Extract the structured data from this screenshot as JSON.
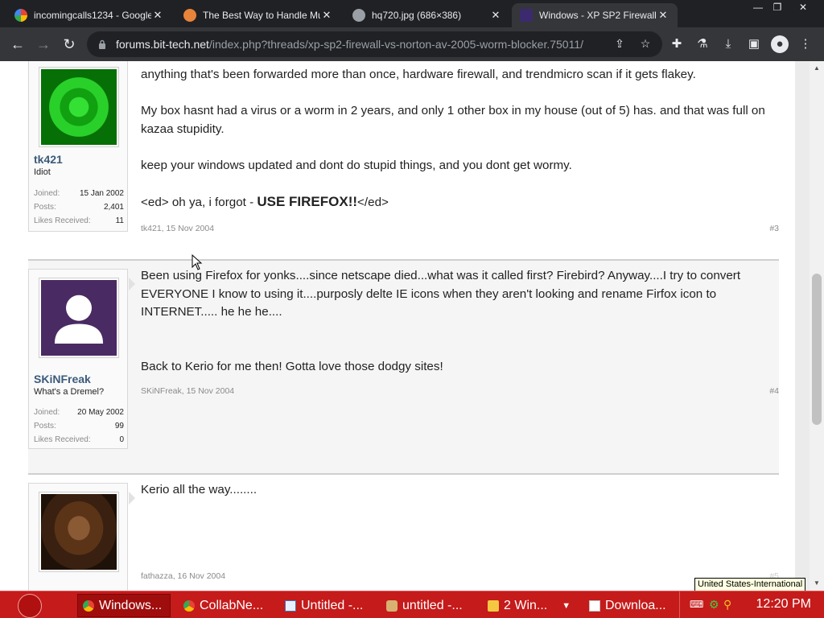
{
  "browser": {
    "tabs": [
      {
        "title": "incomingcalls1234 - Google S",
        "icon": "google-icon",
        "active": false
      },
      {
        "title": "The Best Way to Handle Mul",
        "icon": "site-icon",
        "active": false
      },
      {
        "title": "hq720.jpg (686×386)",
        "icon": "globe-icon",
        "active": false
      },
      {
        "title": "Windows - XP SP2 Firewall Vs",
        "icon": "bittech-icon",
        "active": true
      }
    ],
    "url_host": "forums.bit-tech.net",
    "url_path": "/index.php?threads/xp-sp2-firewall-vs-norton-av-2005-worm-blocker.75011/"
  },
  "posts": [
    {
      "id": "post-3",
      "username": "tk421",
      "user_title": "Idiot",
      "stats": [
        {
          "label": "Joined:",
          "value": "15 Jan 2002"
        },
        {
          "label": "Posts:",
          "value": "2,401"
        },
        {
          "label": "Likes Received:",
          "value": "11"
        }
      ],
      "paragraphs": [
        "anything that's been forwarded more than once, hardware firewall, and trendmicro scan if it gets flakey.",
        "My box hasnt had a virus or a worm in 2 years, and only 1 other box in my house (out of 5) has. and that was full on kazaa stupidity.",
        "keep your windows updated and dont do stupid things, and you dont get wormy."
      ],
      "last_line_prefix": "<ed> oh ya, i forgot - ",
      "last_line_big": "USE FIREFOX!!",
      "last_line_suffix": "</ed>",
      "meta": "tk421, 15 Nov 2004",
      "number": "#3"
    },
    {
      "id": "post-4",
      "username": "SKiNFreak",
      "user_title": "What's a Dremel?",
      "stats": [
        {
          "label": "Joined:",
          "value": "20 May 2002"
        },
        {
          "label": "Posts:",
          "value": "99"
        },
        {
          "label": "Likes Received:",
          "value": "0"
        }
      ],
      "paragraphs": [
        "Been using Firefox for yonks....since netscape died...what was it called first? Firebird? Anyway....I try to convert EVERYONE I know to using it....purposly delte IE icons when they aren't looking and rename Firfox icon to INTERNET..... he he he....",
        "Back to Kerio for me then! Gotta love those dodgy sites!"
      ],
      "meta": "SKiNFreak, 15 Nov 2004",
      "number": "#4"
    },
    {
      "id": "post-5",
      "username": "fathazza",
      "paragraphs": [
        "Kerio all the way........"
      ],
      "meta": "fathazza, 16 Nov 2004",
      "number": "#5"
    }
  ],
  "taskbar": {
    "buttons": [
      {
        "label": "Windows...",
        "icon": "chrome-icon",
        "active": true
      },
      {
        "label": "CollabNe...",
        "icon": "chrome-icon",
        "active": false
      },
      {
        "label": "Untitled -...",
        "icon": "notepad-icon",
        "active": false
      },
      {
        "label": "untitled -...",
        "icon": "paint-icon",
        "active": false
      },
      {
        "label": "2 Win...",
        "icon": "folder-icon",
        "active": false
      },
      {
        "label": "Downloa...",
        "icon": "window-icon",
        "active": false
      }
    ],
    "clock": "12:20 PM",
    "tooltip": "United States-International"
  },
  "colors": {
    "taskbar": "#c51b1b",
    "chrome_dark": "#202124",
    "username": "#3b5a7a",
    "avatar_purple": "#4a2a63"
  }
}
